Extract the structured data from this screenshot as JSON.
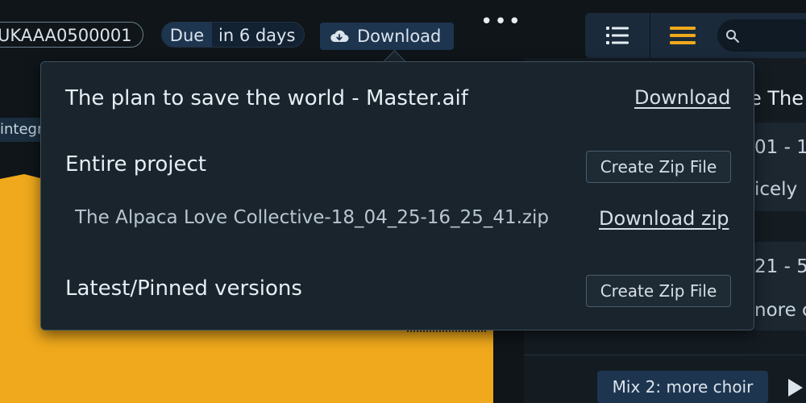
{
  "topbar": {
    "track_id": "UKAAA0500001",
    "due_label": "Due",
    "due_value": "in 6 days",
    "download_label": "Download",
    "more_label": "•••"
  },
  "left_panel": {
    "chip_label": "integr"
  },
  "right_toolbar": {
    "list_view_icon": "list-icon",
    "menu_icon": "menu-icon",
    "search_icon": "search-icon"
  },
  "right_panel": {
    "title_fragment": "e The",
    "card1_line1": "01 - 1",
    "card1_line2": "icely",
    "card2_line1": "21 - 5",
    "card2_line2": "nore c",
    "mix_chip": "Mix 2:  more choir"
  },
  "popover": {
    "master_file": "The plan to save the world - Master.aif",
    "master_download": "Download",
    "entire_project_label": "Entire project",
    "entire_project_button": "Create Zip File",
    "zip_filename": "The Alpaca Love Collective-18_04_25-16_25_41.zip",
    "zip_download": "Download zip",
    "latest_label": "Latest/Pinned versions",
    "latest_button": "Create Zip File"
  },
  "colors": {
    "background": "#0f1519",
    "waveform": "#f0a91c",
    "accent_blue": "#1e3550",
    "popover_bg": "#19242d"
  }
}
